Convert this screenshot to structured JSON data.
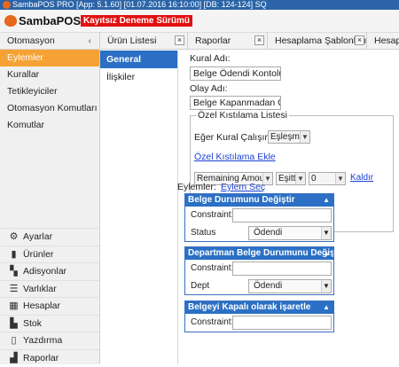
{
  "window": {
    "title": "SambaPOS PRO [App: 5.1.60] [01.07.2016 16:10:00] [DB: 124-124] SQ"
  },
  "brand": {
    "name": "SambaPOS",
    "badge": "Kayıtsız Deneme Sürümü"
  },
  "sidebar": {
    "header": "Otomasyon",
    "items": [
      {
        "label": "Eylemler",
        "active": true
      },
      {
        "label": "Kurallar"
      },
      {
        "label": "Tetikleyiciler"
      },
      {
        "label": "Otomasyon Komutları"
      },
      {
        "label": "Komutlar"
      }
    ],
    "nav": [
      {
        "label": "Ayarlar",
        "icon": "gear-icon"
      },
      {
        "label": "Ürünler",
        "icon": "bottle-icon"
      },
      {
        "label": "Adisyonlar",
        "icon": "tickets-icon"
      },
      {
        "label": "Varlıklar",
        "icon": "list-icon"
      },
      {
        "label": "Hesaplar",
        "icon": "calculator-icon"
      },
      {
        "label": "Stok",
        "icon": "stock-icon"
      },
      {
        "label": "Yazdırma",
        "icon": "document-icon"
      },
      {
        "label": "Raporlar",
        "icon": "bar-chart-icon"
      }
    ]
  },
  "tabs": [
    {
      "label": "Ürün Listesi"
    },
    {
      "label": "Raporlar"
    },
    {
      "label": "Hesaplama Şablonları"
    },
    {
      "label": "Hesaplar"
    }
  ],
  "leftnav": [
    {
      "label": "General Settings",
      "active": true
    },
    {
      "label": "İlişkiler"
    }
  ],
  "form": {
    "rule_name_label": "Kural Adı:",
    "rule_name_value": "Belge Ödendi Kontolü",
    "event_label": "Olay Adı:",
    "event_value": "Belge Kapanmadan Önce",
    "constraint_group_title": "Özel Kıstılama Listesi",
    "rule_run_label": "Eğer Kural Çalışırsa",
    "rule_run_value": "Eşleşmeler",
    "add_constraint_link": "Özel Kıstılama Ekle",
    "constraint_field": "Remaining Amount",
    "constraint_op": "Eşittir",
    "constraint_value": "0",
    "remove_link": "Kaldır",
    "actions_label": "Eylemler:",
    "select_action_link": "Eylem Seç"
  },
  "panels": [
    {
      "title": "Belge Durumunu Değiştir",
      "constraint_label": "Constraint:",
      "field_label": "Status",
      "field_value": "Ödendi"
    },
    {
      "title": "Departman Belge Durumunu Değiştir",
      "constraint_label": "Constraint:",
      "field_label": "Dept",
      "field_value": "Ödendi"
    },
    {
      "title": "Belgeyi Kapalı olarak işaretle",
      "constraint_label": "Constraint:"
    }
  ]
}
